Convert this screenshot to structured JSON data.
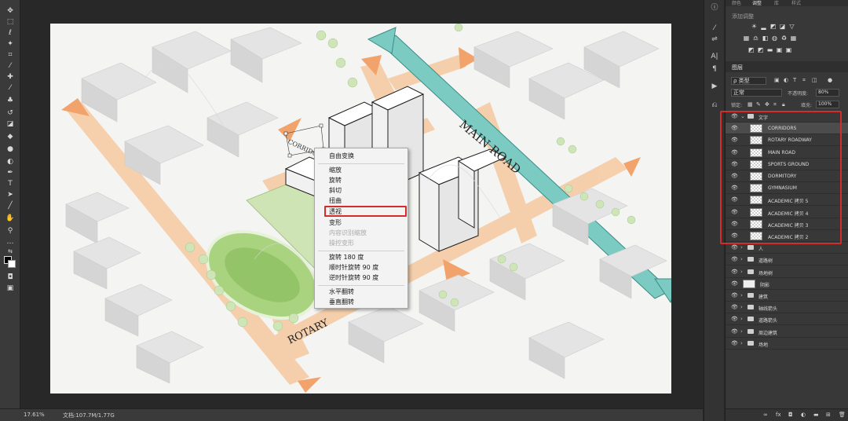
{
  "toolbar": {
    "tools": [
      "move-tool",
      "marquee-tool",
      "lasso-tool",
      "magic-wand-tool",
      "crop-tool",
      "eyedropper-tool",
      "healing-brush-tool",
      "brush-tool",
      "clone-stamp-tool",
      "history-brush-tool",
      "eraser-tool",
      "paint-bucket-tool",
      "blur-tool",
      "dodge-tool",
      "pen-tool",
      "type-tool",
      "path-selection-tool",
      "line-tool",
      "hand-tool",
      "zoom-tool",
      "more-tools"
    ]
  },
  "status": {
    "zoom": "17.61%",
    "doc": "文档:107.7M/1.77G"
  },
  "canvas_labels": {
    "main_road": "MAIN ROAD",
    "rotary": "ROTARY",
    "corridors": "CORRIDORS"
  },
  "colors": {
    "accent_red": "#d62b2b",
    "road_orange": "#f3b98a",
    "arrow_teal": "#6fc7c1",
    "lawn_green": "#a6cf7a",
    "tree_green": "#cfe5b8"
  },
  "context_menu": {
    "items": [
      "自由变换",
      "缩放",
      "旋转",
      "斜切",
      "扭曲",
      "透视",
      "变形",
      "内容识别缩放",
      "操控变形",
      "旋转 180 度",
      "顺时针旋转 90 度",
      "逆时针旋转 90 度",
      "水平翻转",
      "垂直翻转"
    ],
    "highlighted": "透视"
  },
  "adjustments": {
    "tabs": [
      "颜色",
      "调整",
      "库",
      "样式"
    ],
    "add_label": "添加调整"
  },
  "layers": {
    "tab": "图层",
    "kind_filter": "ρ 类型",
    "blend_mode": "正常",
    "opacity_label": "不透明度:",
    "opacity": "80%",
    "lock_label": "锁定:",
    "fill_label": "填充:",
    "fill": "100%",
    "items": [
      {
        "name": "文字",
        "type": "group-open",
        "indent": 0
      },
      {
        "name": "CORRIDORS",
        "type": "layer",
        "indent": 1,
        "selected": true
      },
      {
        "name": "ROTARY ROADWAY",
        "type": "layer",
        "indent": 1
      },
      {
        "name": "MAIN ROAD",
        "type": "layer",
        "indent": 1
      },
      {
        "name": "SPORTS GROUND",
        "type": "layer",
        "indent": 1
      },
      {
        "name": "DORMITORY",
        "type": "layer",
        "indent": 1
      },
      {
        "name": "GYMNASIUM",
        "type": "layer",
        "indent": 1
      },
      {
        "name": "ACADEMIC 拷贝 5",
        "type": "layer",
        "indent": 1
      },
      {
        "name": "ACADEMIC 拷贝 4",
        "type": "layer",
        "indent": 1
      },
      {
        "name": "ACADEMIC 拷贝 3",
        "type": "layer",
        "indent": 1
      },
      {
        "name": "ACADEMIC 拷贝 2",
        "type": "layer",
        "indent": 1
      },
      {
        "name": "人",
        "type": "group",
        "indent": 0
      },
      {
        "name": "道路树",
        "type": "group",
        "indent": 0
      },
      {
        "name": "场地树",
        "type": "group",
        "indent": 0
      },
      {
        "name": "阴影",
        "type": "layer-shadow",
        "indent": 0
      },
      {
        "name": "建筑",
        "type": "group",
        "indent": 0
      },
      {
        "name": "轴线箭头",
        "type": "group",
        "indent": 0
      },
      {
        "name": "道路箭头",
        "type": "group",
        "indent": 0
      },
      {
        "name": "周边建筑",
        "type": "group",
        "indent": 0
      },
      {
        "name": "场地",
        "type": "group",
        "indent": 0
      }
    ]
  }
}
